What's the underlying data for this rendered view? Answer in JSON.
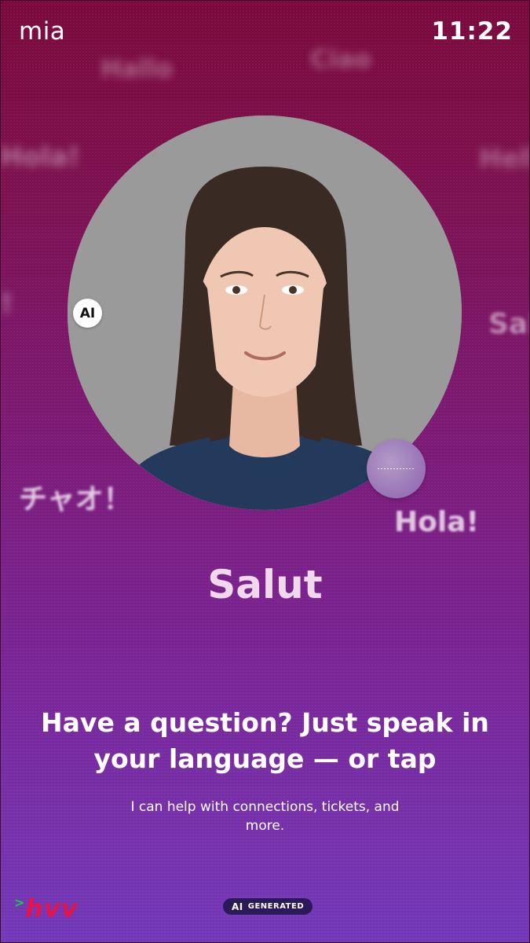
{
  "status": {
    "app_name": "mia",
    "time": "11:22"
  },
  "greetings_bg": [
    "Hallo",
    "Ciao",
    "Hola!",
    "Hello",
    "!",
    "Sal",
    "チャオ！",
    "Hola!"
  ],
  "avatar": {
    "badge": "AI"
  },
  "greeting": "Salut",
  "prompt": {
    "headline": "Have a question? Just speak in your language — or tap",
    "sub": "I can help with connections, tickets, and more."
  },
  "footer": {
    "logo_caret": ">",
    "logo_text": "hvv",
    "ai_label_1": "AI",
    "ai_label_2": "GENERATED"
  },
  "colors": {
    "bg_top": "#7a0a3c",
    "bg_bottom": "#7339b8",
    "logo_red": "#e5144a",
    "logo_green": "#17c94a"
  }
}
